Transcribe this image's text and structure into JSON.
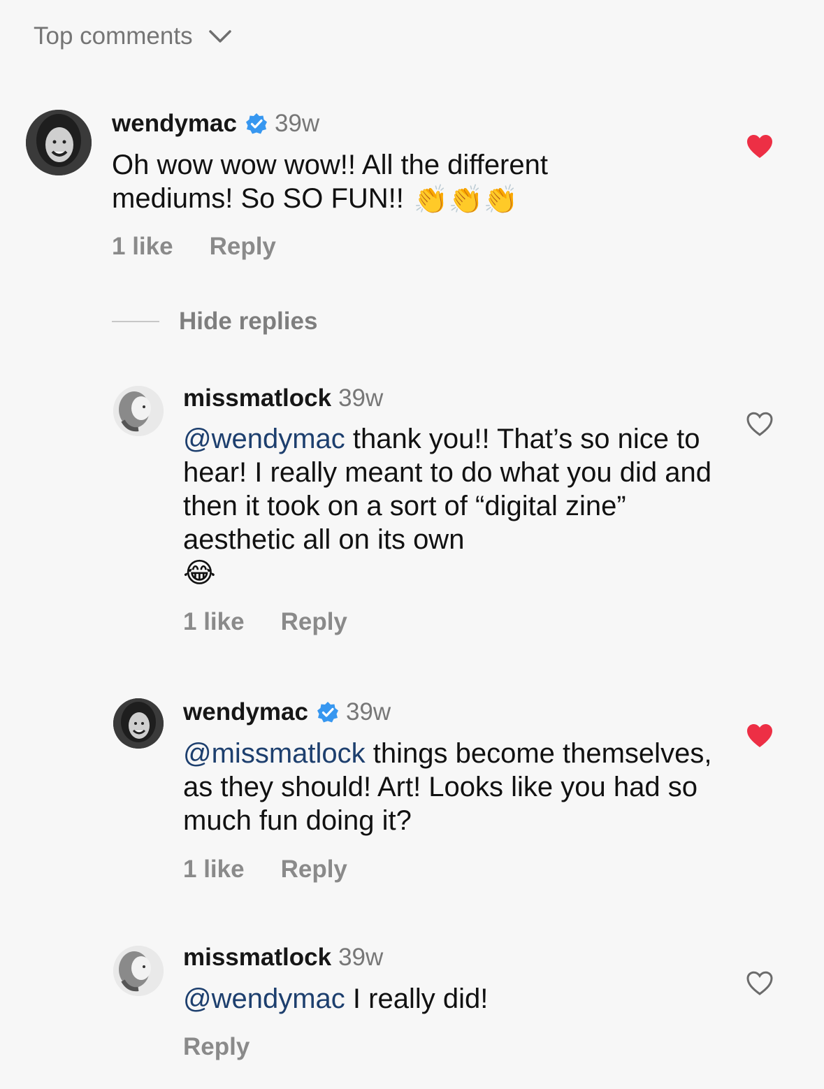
{
  "sort": {
    "label": "Top comments"
  },
  "comments": [
    {
      "username": "wendymac",
      "verified": true,
      "time": "39w",
      "mention": "",
      "text": "Oh wow wow wow!! All the different mediums! So SO FUN!!",
      "emoji": "👏👏👏",
      "likes": "1 like",
      "reply": "Reply",
      "liked": true
    }
  ],
  "replies_toggle": {
    "label": "Hide replies"
  },
  "replies": [
    {
      "username": "missmatlock",
      "verified": false,
      "time": "39w",
      "mention": "@wendymac",
      "text": " thank you!! That’s so nice to hear! I really meant to do what you did and then it took on a sort of “digital zine” aesthetic all on its own",
      "emoji": "😂",
      "likes": "1 like",
      "reply": "Reply",
      "liked": false
    },
    {
      "username": "wendymac",
      "verified": true,
      "time": "39w",
      "mention": "@missmatlock",
      "text": " things become themselves, as they should! Art! Looks like you had so much fun doing it?",
      "emoji": "",
      "likes": "1 like",
      "reply": "Reply",
      "liked": true
    },
    {
      "username": "missmatlock",
      "verified": false,
      "time": "39w",
      "mention": "@wendymac",
      "text": " I really did!",
      "emoji": "",
      "likes": "",
      "reply": "Reply",
      "liked": false
    }
  ],
  "colors": {
    "liked_heart": "#ed2f45",
    "verified_badge": "#3797f0",
    "mention": "#1d3f6e"
  }
}
